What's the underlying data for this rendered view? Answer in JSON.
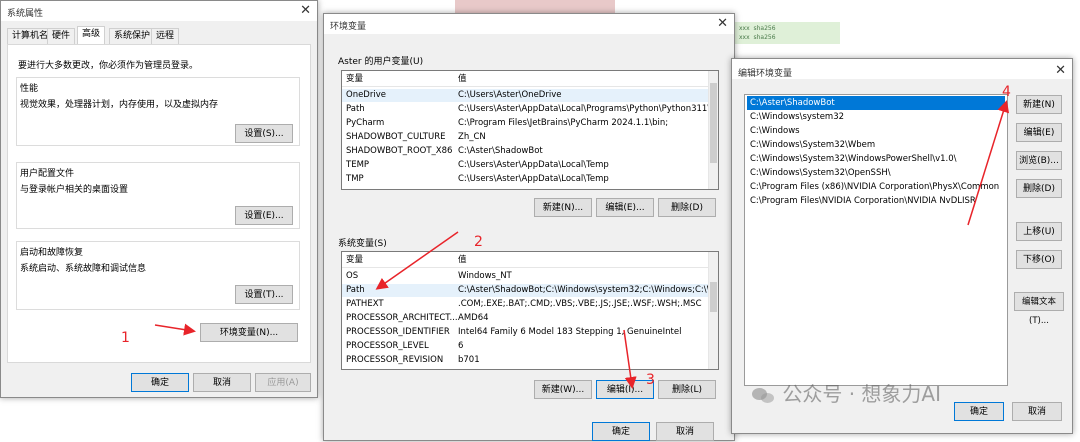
{
  "sysprops": {
    "title": "系统属性",
    "tabs": [
      "计算机名",
      "硬件",
      "高级",
      "系统保护",
      "远程"
    ],
    "admin_note": "要进行大多数更改，你必须作为管理员登录。",
    "perf": {
      "label": "性能",
      "desc": "视觉效果，处理器计划，内存使用，以及虚拟内存",
      "button": "设置(S)..."
    },
    "profiles": {
      "label": "用户配置文件",
      "desc": "与登录帐户相关的桌面设置",
      "button": "设置(E)..."
    },
    "startup": {
      "label": "启动和故障恢复",
      "desc": "系统启动、系统故障和调试信息",
      "button": "设置(T)..."
    },
    "env_button": "环境变量(N)...",
    "ok": "确定",
    "cancel": "取消",
    "apply": "应用(A)"
  },
  "envvars": {
    "title": "环境变量",
    "user_label": "Aster 的用户变量(U)",
    "col_var": "变量",
    "col_val": "值",
    "user_rows": [
      {
        "name": "OneDrive",
        "value": "C:\\Users\\Aster\\OneDrive"
      },
      {
        "name": "Path",
        "value": "C:\\Users\\Aster\\AppData\\Local\\Programs\\Python\\Python311\\..."
      },
      {
        "name": "PyCharm",
        "value": "C:\\Program Files\\JetBrains\\PyCharm 2024.1.1\\bin;"
      },
      {
        "name": "SHADOWBOT_CULTURE",
        "value": "Zh_CN"
      },
      {
        "name": "SHADOWBOT_ROOT_X86",
        "value": "C:\\Aster\\ShadowBot"
      },
      {
        "name": "TEMP",
        "value": "C:\\Users\\Aster\\AppData\\Local\\Temp"
      },
      {
        "name": "TMP",
        "value": "C:\\Users\\Aster\\AppData\\Local\\Temp"
      }
    ],
    "user_buttons": {
      "new": "新建(N)...",
      "edit": "编辑(E)...",
      "delete": "删除(D)"
    },
    "sys_label": "系统变量(S)",
    "sys_rows": [
      {
        "name": "OS",
        "value": "Windows_NT"
      },
      {
        "name": "Path",
        "value": "C:\\Aster\\ShadowBot;C:\\Windows\\system32;C:\\Windows;C:\\Wi..."
      },
      {
        "name": "PATHEXT",
        "value": ".COM;.EXE;.BAT;.CMD;.VBS;.VBE;.JS;.JSE;.WSF;.WSH;.MSC"
      },
      {
        "name": "PROCESSOR_ARCHITECT...",
        "value": "AMD64"
      },
      {
        "name": "PROCESSOR_IDENTIFIER",
        "value": "Intel64 Family 6 Model 183 Stepping 1, GenuineIntel"
      },
      {
        "name": "PROCESSOR_LEVEL",
        "value": "6"
      },
      {
        "name": "PROCESSOR_REVISION",
        "value": "b701"
      }
    ],
    "sys_buttons": {
      "new": "新建(W)...",
      "edit": "编辑(I)...",
      "delete": "删除(L)"
    },
    "ok": "确定",
    "cancel": "取消"
  },
  "editenv": {
    "title": "编辑环境变量",
    "paths": [
      "C:\\Aster\\ShadowBot",
      "C:\\Windows\\system32",
      "C:\\Windows",
      "C:\\Windows\\System32\\Wbem",
      "C:\\Windows\\System32\\WindowsPowerShell\\v1.0\\",
      "C:\\Windows\\System32\\OpenSSH\\",
      "C:\\Program Files (x86)\\NVIDIA Corporation\\PhysX\\Common",
      "C:\\Program Files\\NVIDIA Corporation\\NVIDIA NvDLISR"
    ],
    "buttons": {
      "new": "新建(N)",
      "edit": "编辑(E)",
      "browse": "浏览(B)...",
      "delete": "删除(D)",
      "up": "上移(U)",
      "down": "下移(O)",
      "edit_text": "编辑文本(T)..."
    },
    "ok": "确定",
    "cancel": "取消"
  },
  "annotations": {
    "n1": "1",
    "n2": "2",
    "n3": "3",
    "n4": "4",
    "color": "#e8242a"
  },
  "watermark": "公众号 · 想象力AI",
  "bg_snippets": {
    "l1a": "xxx",
    "l1b": "sha256",
    "l2a": "xxx",
    "l2b": "sha256"
  }
}
